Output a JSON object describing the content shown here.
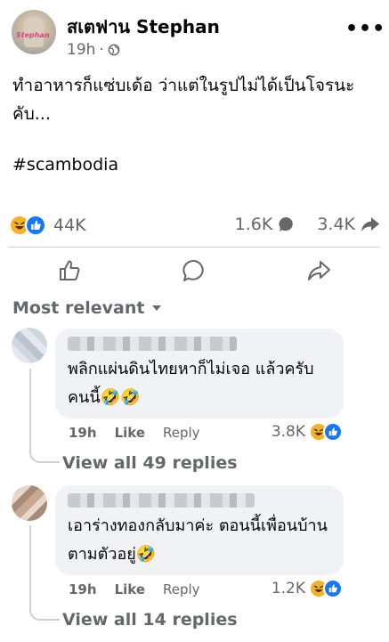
{
  "post": {
    "author": "สเตฟาน Stephan",
    "time": "19h",
    "separator": "·",
    "text": "ทำอาหารก็แซ่บเด้อ ว่าแต่ในรูปไม่ได้เป็นโจรนะคับ...",
    "hashtag": "#scambodia",
    "reaction_count": "44K",
    "comment_count": "1.6K",
    "share_count": "3.4K",
    "avatar_caption": "Stephan"
  },
  "sort_label": "Most relevant",
  "comments": [
    {
      "text": "พลิกแผ่นดินไทยหาก็ไม่เจอ แล้วครับคนนี้🤣🤣",
      "time": "19h",
      "like_label": "Like",
      "reply_label": "Reply",
      "reaction_count": "3.8K",
      "replies_label": "View all 49 replies"
    },
    {
      "text": "เอาร่างทองกลับมาค่ะ ตอนนี้เพื่อนบ้านตามตัวอยู่🤣",
      "time": "19h",
      "like_label": "Like",
      "reply_label": "Reply",
      "reaction_count": "1.2K",
      "replies_label": "View all 14 replies"
    }
  ],
  "colors": {
    "like_blue": "#1877f2",
    "haha_yellow": "#f7b125",
    "secondary_text": "#65676b",
    "bubble": "#f0f2f5"
  },
  "icons": [
    "globe-icon",
    "more-icon",
    "haha-icon",
    "like-icon",
    "comment-icon",
    "share-icon",
    "caret-down-icon"
  ]
}
